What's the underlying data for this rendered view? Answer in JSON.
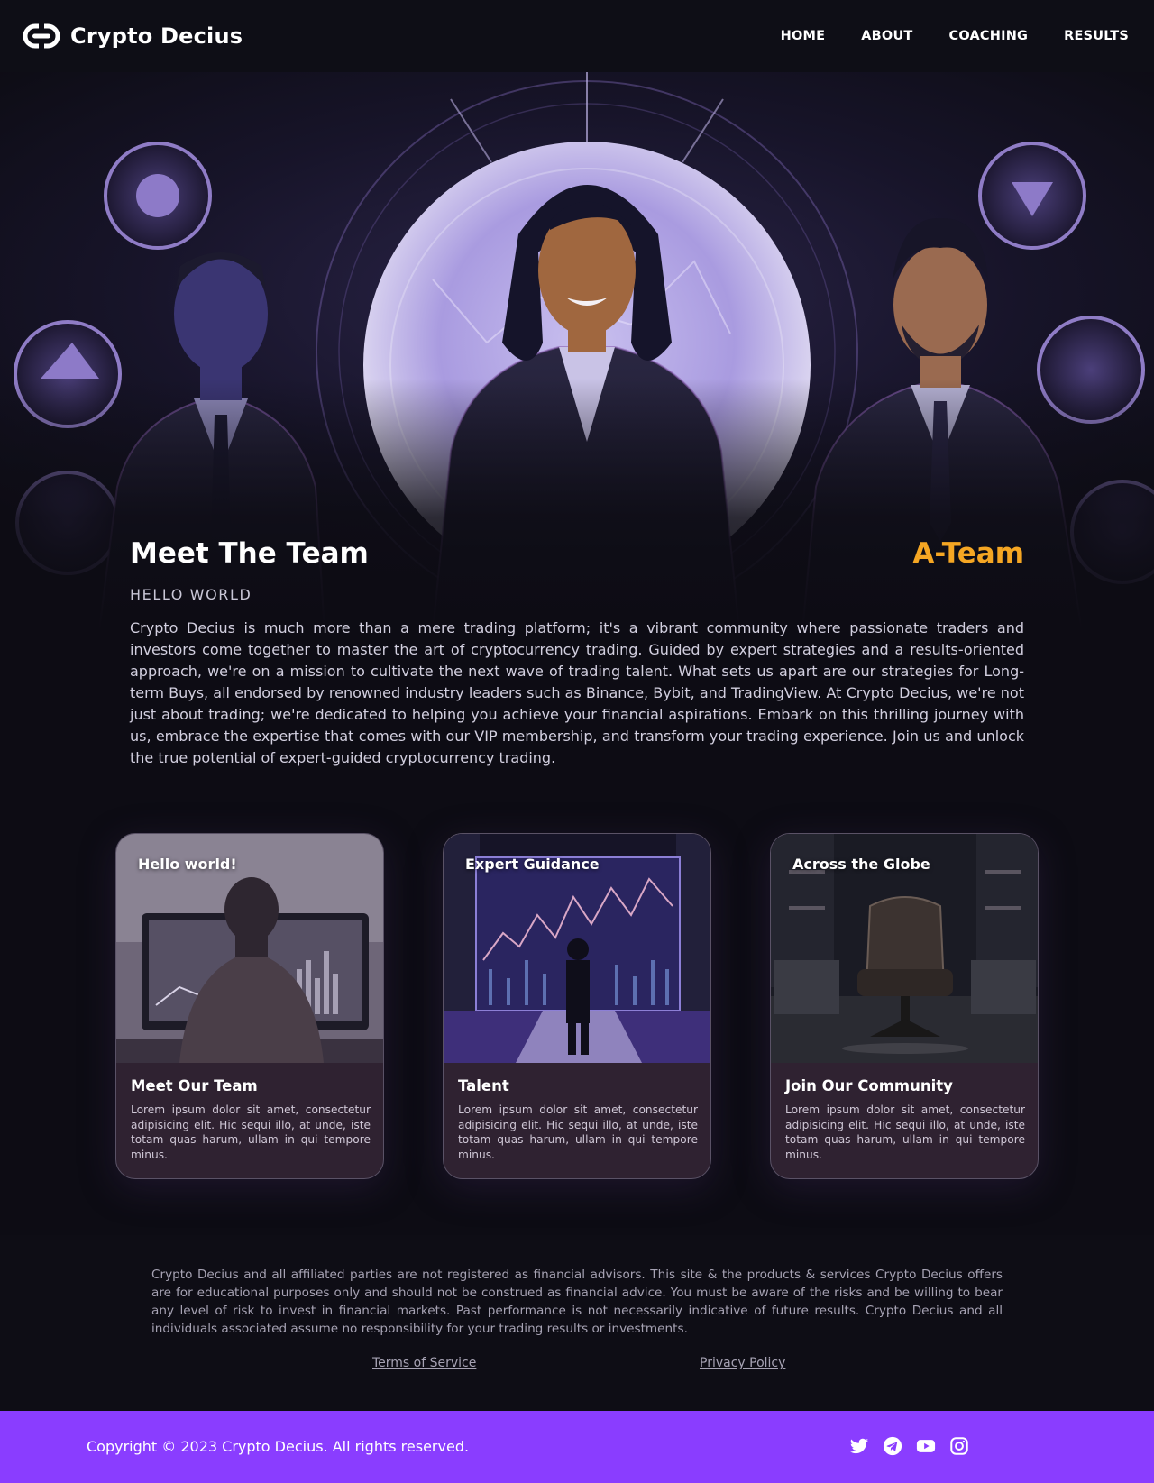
{
  "brand": {
    "name": "Crypto Decius",
    "logo_icon": "link-logo-icon"
  },
  "nav": {
    "items": [
      {
        "label": "HOME"
      },
      {
        "label": "ABOUT"
      },
      {
        "label": "COACHING"
      },
      {
        "label": "RESULTS"
      }
    ]
  },
  "hero": {
    "image": "team-illustration"
  },
  "intro": {
    "title": "Meet The Team",
    "accent": "A-Team",
    "kicker": "HELLO WORLD",
    "body": "Crypto Decius is much more than a mere trading platform; it's a vibrant community where passionate traders and investors come together to master the art of cryptocurrency trading. Guided by expert strategies and a results-oriented approach, we're on a mission to cultivate the next wave of trading talent. What sets us apart are our strategies for Long-term Buys, all endorsed by renowned industry leaders such as Binance, Bybit, and TradingView. At Crypto Decius, we're not just about trading; we're dedicated to helping you achieve your financial aspirations. Embark on this thrilling journey with us, embrace the expertise that comes with our VIP membership, and transform your trading experience. Join us and unlock the true potential of expert-guided cryptocurrency trading."
  },
  "cards": [
    {
      "overlay_title": "Hello world!",
      "title": "Meet Our Team",
      "text": "Lorem ipsum dolor sit amet, consectetur adipisicing elit. Hic sequi illo, at unde, iste totam quas harum, ullam in qui tempore minus."
    },
    {
      "overlay_title": "Expert Guidance",
      "title": "Talent",
      "text": "Lorem ipsum dolor sit amet, consectetur adipisicing elit. Hic sequi illo, at unde, iste totam quas harum, ullam in qui tempore minus."
    },
    {
      "overlay_title": "Across the Globe",
      "title": "Join Our Community",
      "text": "Lorem ipsum dolor sit amet, consectetur adipisicing elit. Hic sequi illo, at unde, iste totam quas harum, ullam in qui tempore minus."
    }
  ],
  "disclaimer": {
    "text": "Crypto Decius and all affiliated parties are not registered as financial advisors. This site & the products & services Crypto Decius offers are for educational purposes only and should not be construed as financial advice. You must be aware of the risks and be willing to bear any level of risk to invest in financial markets. Past performance is not necessarily indicative of future results. Crypto Decius and all individuals associated assume no responsibility for your trading results or investments.",
    "terms_label": "Terms of Service",
    "privacy_label": "Privacy Policy"
  },
  "footer": {
    "copyright": "Copyright © 2023 Crypto Decius. All rights reserved.",
    "socials": [
      "twitter-icon",
      "telegram-icon",
      "youtube-icon",
      "instagram-icon"
    ]
  },
  "colors": {
    "accent_orange": "#f5a623",
    "footer_purple": "#8a3dff",
    "background": "#0d0c14",
    "card_body": "#2f2231"
  }
}
